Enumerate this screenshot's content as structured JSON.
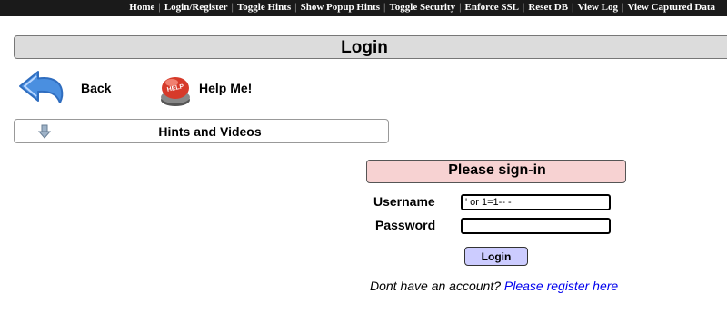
{
  "topnav": {
    "items": [
      "Home",
      "Login/Register",
      "Toggle Hints",
      "Show Popup Hints",
      "Toggle Security",
      "Enforce SSL",
      "Reset DB",
      "View Log",
      "View Captured Data"
    ]
  },
  "page": {
    "title": "Login"
  },
  "nav": {
    "back_label": "Back",
    "help_label": "Help Me!",
    "help_badge": "HELP"
  },
  "hints": {
    "label": "Hints and Videos"
  },
  "form": {
    "heading": "Please sign-in",
    "username_label": "Username",
    "username_value": "' or 1=1-- -",
    "password_label": "Password",
    "password_value": "",
    "submit_label": "Login"
  },
  "footer": {
    "text": "Dont have an account? ",
    "link": "Please register here"
  },
  "colors": {
    "topbar": "#1a1a1a",
    "header_bg": "#dcdcdc",
    "signin_bg": "#f7d2d2",
    "button_bg": "#ccccff",
    "link": "#0000ee",
    "back_icon": "#4a8fe0",
    "help_icon": "#d63a2a"
  },
  "icons": {
    "back": "curved-back-arrow-icon",
    "help": "red-help-button-icon",
    "hints": "down-arrow-icon"
  }
}
